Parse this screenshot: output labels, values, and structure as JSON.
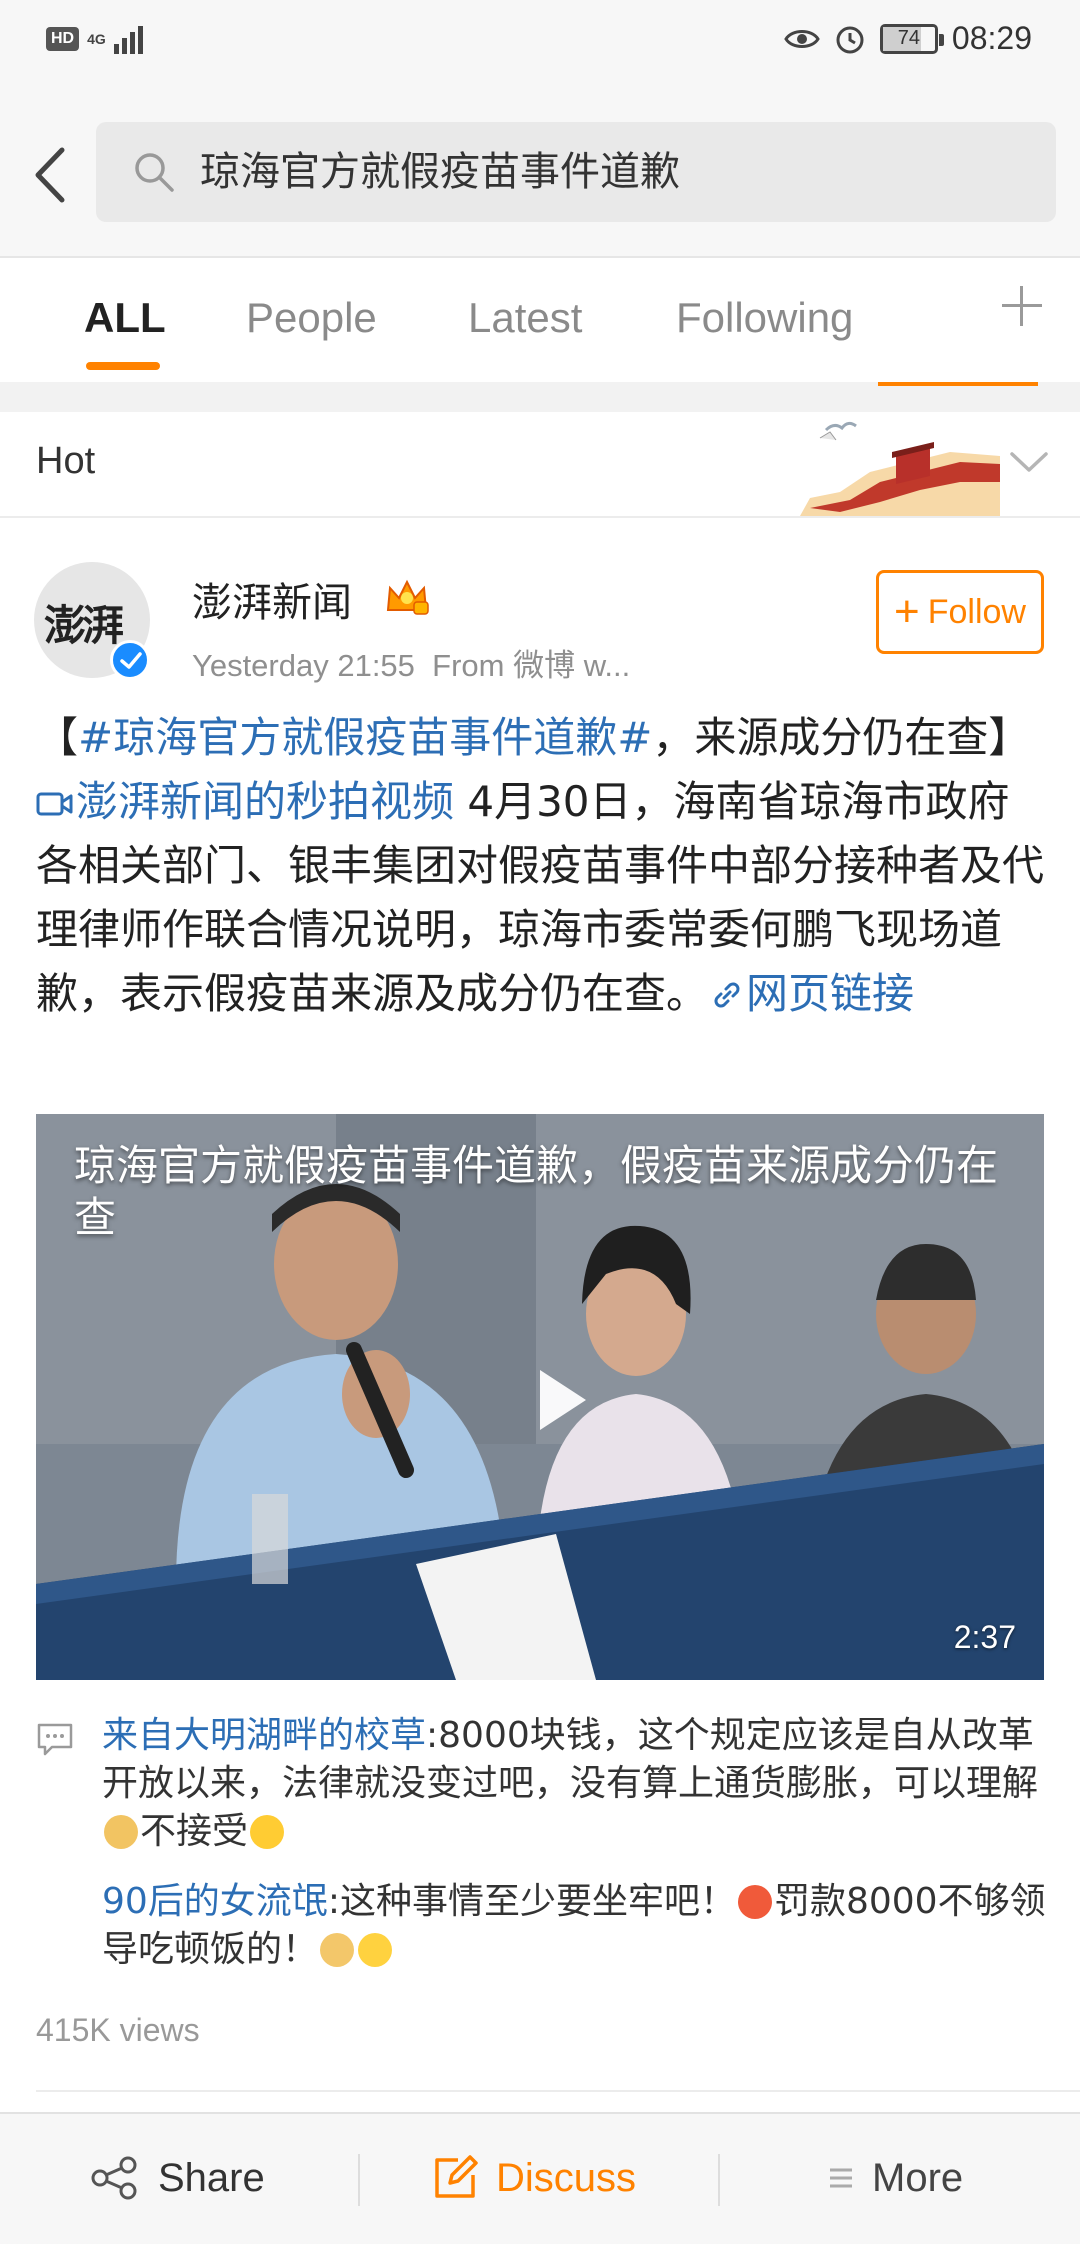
{
  "status_bar": {
    "hd": "HD",
    "network": "4G",
    "battery": "74",
    "battery_level": 0.74,
    "time": "08:29"
  },
  "search": {
    "query": "琼海官方就假疫苗事件道歉"
  },
  "tabs": [
    {
      "label": "ALL",
      "active": true
    },
    {
      "label": "People",
      "active": false
    },
    {
      "label": "Latest",
      "active": false
    },
    {
      "label": "Following",
      "active": false
    }
  ],
  "hot": {
    "label": "Hot"
  },
  "post": {
    "author": "澎湃新闻",
    "avatar_text": "澎湃",
    "time": "Yesterday 21:55",
    "source": "From 微博 w...",
    "follow_label": "Follow",
    "body": {
      "bracket_open": "【",
      "hashtag": "#琼海官方就假疫苗事件道歉#",
      "headline_rest": "，来源成分仍在查】",
      "video_link": "澎湃新闻的秒拍视频",
      "text": " 4月30日，海南省琼海市政府各相关部门、银丰集团对假疫苗事件中部分接种者及代理律师作联合情况说明，琼海市委常委何鹏飞现场道歉，表示假疫苗来源及成分仍在查。",
      "web_link": "网页链接"
    },
    "video": {
      "title": "琼海官方就假疫苗事件道歉，假疫苗来源成分仍在查",
      "duration": "2:37"
    },
    "comments": [
      {
        "user": "来自大明湖畔的校草",
        "text_before": ":8000块钱，这个规定应该是自从改革开放以来，法律就没变过吧，没有算上通货膨胀，可以理解",
        "text_mid": "不接受",
        "text_after": ""
      },
      {
        "user": "90后的女流氓",
        "text_before": ":这种事情至少要坐牢吧！",
        "text_mid": "罚款8000不够领导吃顿饭的！",
        "text_after": ""
      }
    ],
    "views": "415K views"
  },
  "bottom_bar": {
    "share": "Share",
    "discuss": "Discuss",
    "more": "More"
  },
  "colors": {
    "accent": "#ff8200",
    "link": "#2c6eb5",
    "verified": "#1a8cff"
  }
}
